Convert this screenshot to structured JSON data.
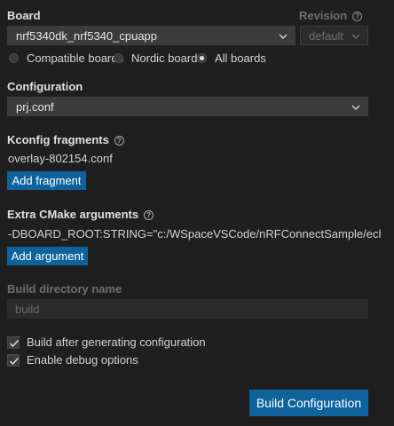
{
  "board": {
    "label": "Board",
    "value": "nrf5340dk_nrf5340_cpuapp",
    "options": [
      {
        "label": "Compatible boards",
        "selected": false
      },
      {
        "label": "Nordic boards",
        "selected": false
      },
      {
        "label": "All boards",
        "selected": true
      }
    ]
  },
  "revision": {
    "label": "Revision",
    "value": "default"
  },
  "configuration": {
    "label": "Configuration",
    "value": "prj.conf"
  },
  "kconfig": {
    "label": "Kconfig fragments",
    "file": "overlay-802154.conf",
    "button": "Add fragment"
  },
  "cmake": {
    "label": "Extra CMake arguments",
    "argument": "-DBOARD_ROOT:STRING=\"c:/WSpaceVSCode/nRFConnectSample/echo_cli...",
    "button": "Add argument"
  },
  "build_dir": {
    "label": "Build directory name",
    "value": "build"
  },
  "options": {
    "build_after": {
      "label": "Build after generating configuration",
      "checked": true
    },
    "debug": {
      "label": "Enable debug options",
      "checked": true
    }
  },
  "submit": {
    "label": "Build Configuration"
  }
}
